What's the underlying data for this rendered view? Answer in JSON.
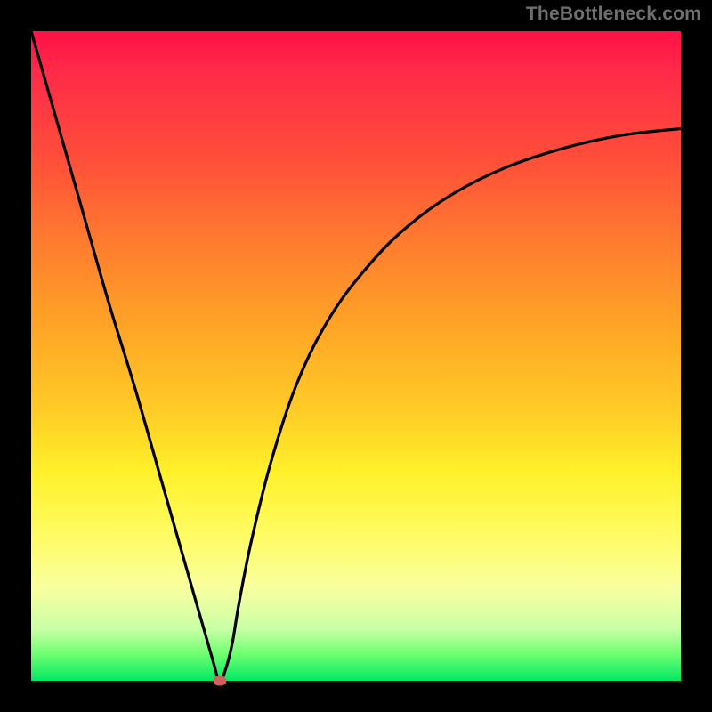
{
  "watermark": "TheBottleneck.com",
  "chart_data": {
    "type": "line",
    "title": "",
    "xlabel": "",
    "ylabel": "",
    "xlim": [
      0,
      100
    ],
    "ylim": [
      0,
      100
    ],
    "grid": false,
    "legend": false,
    "annotations": [],
    "background_gradient": {
      "orientation": "vertical",
      "stops": [
        {
          "pct": 0,
          "color": "#ff1146"
        },
        {
          "pct": 20,
          "color": "#ff4f39"
        },
        {
          "pct": 45,
          "color": "#ffa326"
        },
        {
          "pct": 68,
          "color": "#fff12a"
        },
        {
          "pct": 86,
          "color": "#f8ffa0"
        },
        {
          "pct": 100,
          "color": "#00e765"
        }
      ]
    },
    "series": [
      {
        "name": "bottleneck-curve",
        "color": "#000000",
        "x": [
          0,
          4,
          8,
          12,
          16,
          20,
          24,
          26,
          28,
          29,
          30,
          31,
          32,
          34,
          37,
          41,
          46,
          52,
          58,
          65,
          73,
          82,
          91,
          100
        ],
        "y": [
          100,
          86,
          72,
          58,
          45,
          31,
          17,
          10,
          3,
          0,
          2,
          6,
          12,
          22,
          34,
          46,
          56,
          64,
          70,
          75,
          79,
          82,
          84,
          85
        ]
      }
    ],
    "marker": {
      "x": 29,
      "y": 0,
      "color": "#d5605e"
    }
  }
}
